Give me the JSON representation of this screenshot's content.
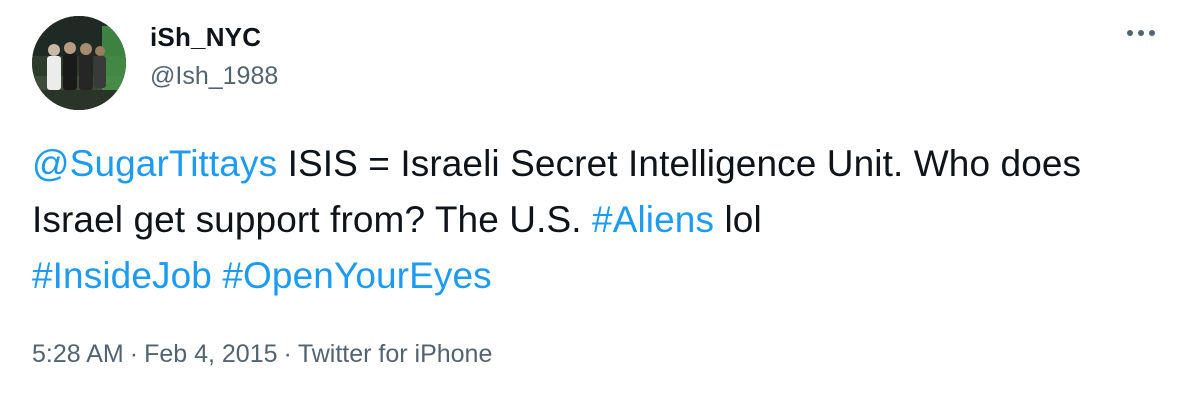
{
  "colors": {
    "link": "#1d9bf0",
    "text": "#0f1419",
    "secondary": "#536471",
    "background": "#ffffff"
  },
  "author": {
    "display_name": "iSh_NYC",
    "handle": "@Ish_1988",
    "avatar_icon": "profile-photo-group"
  },
  "more_icon": "more-horizontal-icon",
  "tweet": {
    "segments": [
      {
        "type": "mention",
        "text": "@SugarTittays"
      },
      {
        "type": "text",
        "text": " ISIS = Israeli Secret Intelligence Unit. Who does Israel get support from? The U.S. "
      },
      {
        "type": "hashtag",
        "text": "#Aliens"
      },
      {
        "type": "text",
        "text": " lol "
      },
      {
        "type": "hashtag",
        "text": "#InsideJob"
      },
      {
        "type": "text",
        "text": " "
      },
      {
        "type": "hashtag",
        "text": "#OpenYourEyes"
      }
    ]
  },
  "meta": {
    "time": "5:28 AM",
    "separator": "·",
    "date": "Feb 4, 2015",
    "source": "Twitter for iPhone"
  }
}
